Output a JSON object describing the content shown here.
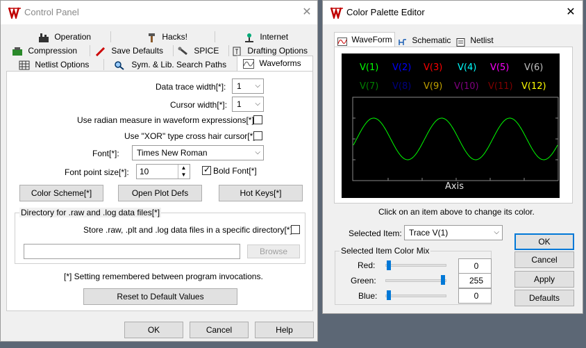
{
  "control_panel": {
    "title": "Control Panel",
    "tabs_row1": [
      "Operation",
      "Hacks!",
      "Internet"
    ],
    "tabs_row2": [
      "Compression",
      "Save Defaults",
      "SPICE",
      "Drafting Options"
    ],
    "tabs_row3": [
      "Netlist Options",
      "Sym. & Lib. Search Paths",
      "Waveforms"
    ],
    "data_trace_width_label": "Data trace width[*]:",
    "data_trace_width_value": "1",
    "cursor_width_label": "Cursor width[*]:",
    "cursor_width_value": "1",
    "radian_label": "Use radian measure in waveform expressions[*]",
    "xor_label": "Use \"XOR\" type cross hair cursor[*]",
    "font_label": "Font[*]:",
    "font_value": "Times New Roman",
    "font_size_label": "Font point size[*]:",
    "font_size_value": "10",
    "bold_label": "Bold Font[*]",
    "color_scheme_button": "Color Scheme[*]",
    "open_plot_defs_button": "Open Plot Defs",
    "hot_keys_button": "Hot Keys[*]",
    "dir_group_title": "Directory for .raw and .log data files[*]",
    "store_label": "Store .raw, .plt and .log data files in a specific directory[*]",
    "dir_path_value": "",
    "browse_button": "Browse",
    "remember_note": "[*] Setting remembered between program invocations.",
    "reset_button": "Reset to Default Values",
    "ok_button": "OK",
    "cancel_button": "Cancel",
    "help_button": "Help",
    "bold_checked": true,
    "radian_checked": false,
    "xor_checked": false,
    "store_checked": false
  },
  "palette": {
    "title": "Color Palette Editor",
    "tabs": [
      "WaveForm",
      "Schematic",
      "Netlist"
    ],
    "traces_row1": [
      {
        "label": "V(1)",
        "color": "#00ff00"
      },
      {
        "label": "V(2)",
        "color": "#0000ff"
      },
      {
        "label": "V(3)",
        "color": "#ff0000"
      },
      {
        "label": "V(4)",
        "color": "#00ffff"
      },
      {
        "label": "V(5)",
        "color": "#ff00ff"
      },
      {
        "label": "V(6)",
        "color": "#c0c0c0"
      }
    ],
    "traces_row2": [
      {
        "label": "V(7)",
        "color": "#008000"
      },
      {
        "label": "V(8)",
        "color": "#000080"
      },
      {
        "label": "V(9)",
        "color": "#c0a000"
      },
      {
        "label": "V(10)",
        "color": "#800080"
      },
      {
        "label": "V(11)",
        "color": "#800000"
      },
      {
        "label": "V(12)",
        "color": "#ffff00"
      }
    ],
    "axis_label": "Axis",
    "hint": "Click on an item above to change its color.",
    "selected_item_label": "Selected Item:",
    "selected_item_value": "Trace  V(1)",
    "color_mix_title": "Selected Item Color Mix",
    "red_label": "Red:",
    "red_value": "0",
    "green_label": "Green:",
    "green_value": "255",
    "blue_label": "Blue:",
    "blue_value": "0",
    "ok_button": "OK",
    "cancel_button": "Cancel",
    "apply_button": "Apply",
    "defaults_button": "Defaults"
  },
  "colors": {
    "accent": "#0078d7",
    "plot_background": "#000000",
    "trace": "#00ff00"
  }
}
